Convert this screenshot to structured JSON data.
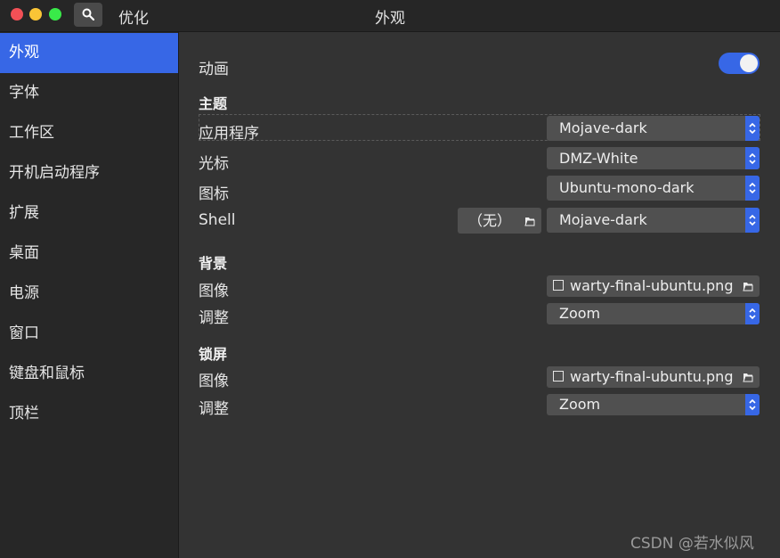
{
  "titlebar": {
    "app_title": "优化",
    "window_title": "外观",
    "search_icon": "search-icon"
  },
  "sidebar": {
    "items": [
      {
        "label": "外观",
        "active": true
      },
      {
        "label": "字体",
        "active": false
      },
      {
        "label": "工作区",
        "active": false
      },
      {
        "label": "开机启动程序",
        "active": false
      },
      {
        "label": "扩展",
        "active": false
      },
      {
        "label": "桌面",
        "active": false
      },
      {
        "label": "电源",
        "active": false
      },
      {
        "label": "窗口",
        "active": false
      },
      {
        "label": "键盘和鼠标",
        "active": false
      },
      {
        "label": "顶栏",
        "active": false
      }
    ]
  },
  "main": {
    "animation": {
      "label": "动画",
      "enabled": true
    },
    "themes": {
      "heading": "主题",
      "applications": {
        "label": "应用程序",
        "value": "Mojave-dark"
      },
      "cursor": {
        "label": "光标",
        "value": "DMZ-White"
      },
      "icons": {
        "label": "图标",
        "value": "Ubuntu-mono-dark"
      },
      "shell": {
        "label": "Shell",
        "none_label": "（无）",
        "value": "Mojave-dark"
      }
    },
    "background": {
      "heading": "背景",
      "image": {
        "label": "图像",
        "value": "warty-final-ubuntu.png"
      },
      "adjustment": {
        "label": "调整",
        "value": "Zoom"
      }
    },
    "lock_screen": {
      "heading": "锁屏",
      "image": {
        "label": "图像",
        "value": "warty-final-ubuntu.png"
      },
      "adjustment": {
        "label": "调整",
        "value": "Zoom"
      }
    }
  },
  "watermark": "CSDN @若水似风",
  "colors": {
    "accent": "#3767e6",
    "close": "#f25056",
    "minimize": "#fac536",
    "maximize": "#39ea49"
  }
}
